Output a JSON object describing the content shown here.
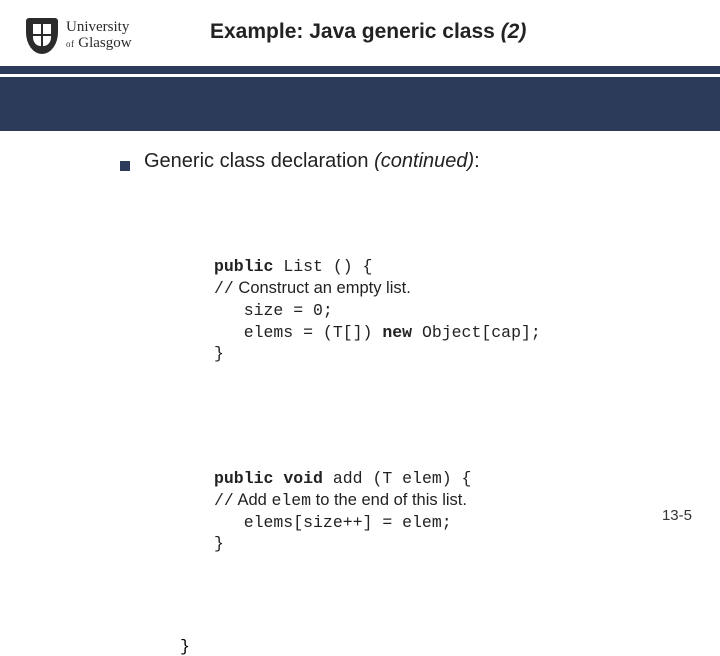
{
  "logo": {
    "line1": "University",
    "of": "of",
    "line2": "Glasgow"
  },
  "title": {
    "text": "Example: Java generic class ",
    "paren": "(2)"
  },
  "bullet": {
    "text": "Generic class declaration ",
    "cont": "(continued)",
    "colon": ":"
  },
  "code1": {
    "sig_kw": "public",
    "sig_rest": " List () {",
    "comment_slashes": "//",
    "comment_text": " Construct an empty list.",
    "line_size": "   size = 0;",
    "line_elems1": "   elems = (T[]) ",
    "kw_new": "new",
    "line_elems2": " Object[cap];",
    "close": "}"
  },
  "code2": {
    "sig_kw1": "public",
    "sig_kw2": " void",
    "sig_rest": " add (T elem) {",
    "comment_slashes": "//",
    "comment_pre": " Add ",
    "comment_code": "elem",
    "comment_post": " to the end of this list.",
    "line_body": "   elems[size++] = elem;",
    "close": "}"
  },
  "outer_close": "}",
  "pagenum": "13-5"
}
